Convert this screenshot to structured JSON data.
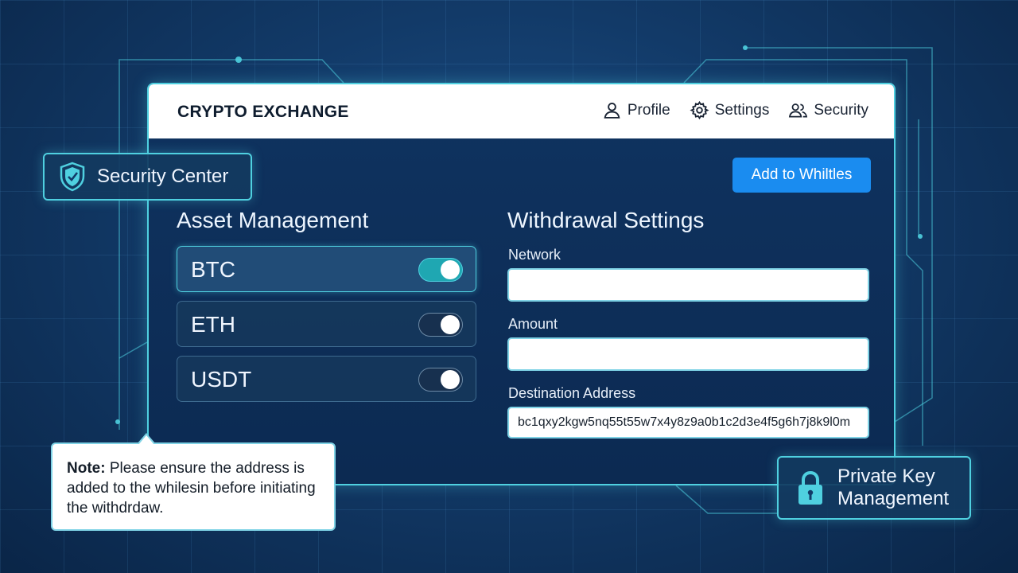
{
  "header": {
    "brand": "CRYPTO EXCHANGE",
    "nav": [
      {
        "label": "Profile",
        "icon": "user-icon"
      },
      {
        "label": "Settings",
        "icon": "gear-icon"
      },
      {
        "label": "Security",
        "icon": "users-icon"
      }
    ]
  },
  "toolbar": {
    "add_label": "Add to Whiltles"
  },
  "security_center": {
    "label": "Security Center",
    "icon": "shield-check-icon"
  },
  "assets": {
    "title": "Asset Management",
    "items": [
      {
        "label": "BTC",
        "enabled": true
      },
      {
        "label": "ETH",
        "enabled": false
      },
      {
        "label": "USDT",
        "enabled": false
      }
    ]
  },
  "withdrawal": {
    "title": "Withdrawal Settings",
    "network_label": "Network",
    "network_value": "",
    "amount_label": "Amount",
    "amount_value": "",
    "address_label": "Destination Address",
    "address_value": "bc1qxy2kgw5nq55t55w7x4y8z9a0b1c2d3e4f5g6h7j8k9l0m"
  },
  "note": {
    "prefix": "Note:",
    "text": " Please ensure the address is added to the whilesin before initiating the withdrdaw."
  },
  "private_key": {
    "line1": "Private Key",
    "line2": "Management",
    "icon": "lock-icon"
  },
  "colors": {
    "accent": "#4fd0e0",
    "primary_button": "#1a8cf0",
    "toggle_on": "#1fa7b2",
    "background": "#123a68"
  }
}
